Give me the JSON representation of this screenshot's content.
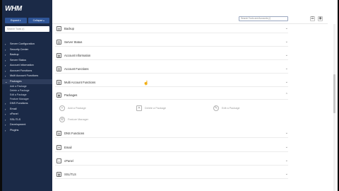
{
  "app": {
    "logo": "WHM",
    "expand_label": "Expand",
    "collapse_label": "Collapse",
    "sidebar_search_placeholder": "Search Tools (/)",
    "top_search_placeholder": "Search Tools and Accounts (/)"
  },
  "sidebar": {
    "items": [
      {
        "label": "Server Configuration"
      },
      {
        "label": "Security Center"
      },
      {
        "label": "Backup"
      },
      {
        "label": "Server Status"
      },
      {
        "label": "Account Information"
      },
      {
        "label": "Account Functions"
      },
      {
        "label": "Multi Account Functions"
      },
      {
        "label": "Packages"
      }
    ],
    "sub_items": [
      {
        "label": "Add a Package"
      },
      {
        "label": "Delete a Package"
      },
      {
        "label": "Edit a Package"
      },
      {
        "label": "Feature Manager"
      }
    ],
    "items_after": [
      {
        "label": "DNS Functions"
      },
      {
        "label": "Email"
      },
      {
        "label": "cPanel"
      },
      {
        "label": "SSL/TLS"
      },
      {
        "label": "Development"
      },
      {
        "label": "Plugins"
      }
    ]
  },
  "main": {
    "rows": [
      {
        "label": "Backup",
        "icon": "backup-icon"
      },
      {
        "label": "Server Status",
        "icon": "server-status-icon"
      },
      {
        "label": "Account Information",
        "icon": "account-information-icon"
      },
      {
        "label": "Account Functions",
        "icon": "account-functions-icon"
      },
      {
        "label": "Multi Account Functions",
        "icon": "multi-account-icon"
      },
      {
        "label": "Packages",
        "icon": "packages-icon"
      }
    ],
    "packages": [
      {
        "label": "Add a Package",
        "icon": "add-package-icon"
      },
      {
        "label": "Delete a Package",
        "icon": "delete-package-icon"
      },
      {
        "label": "Edit a Package",
        "icon": "edit-package-icon"
      },
      {
        "label": "Feature Manager",
        "icon": "feature-manager-icon"
      }
    ],
    "rows_after": [
      {
        "label": "DNS Functions",
        "icon": "dns-functions-icon"
      },
      {
        "label": "Email",
        "icon": "email-icon"
      },
      {
        "label": "cPanel",
        "icon": "cpanel-icon"
      },
      {
        "label": "SSL/TLS",
        "icon": "ssl-tls-icon"
      }
    ]
  },
  "colors": {
    "sidebar_bg": "#1b2a47",
    "accent": "#2f5597"
  }
}
